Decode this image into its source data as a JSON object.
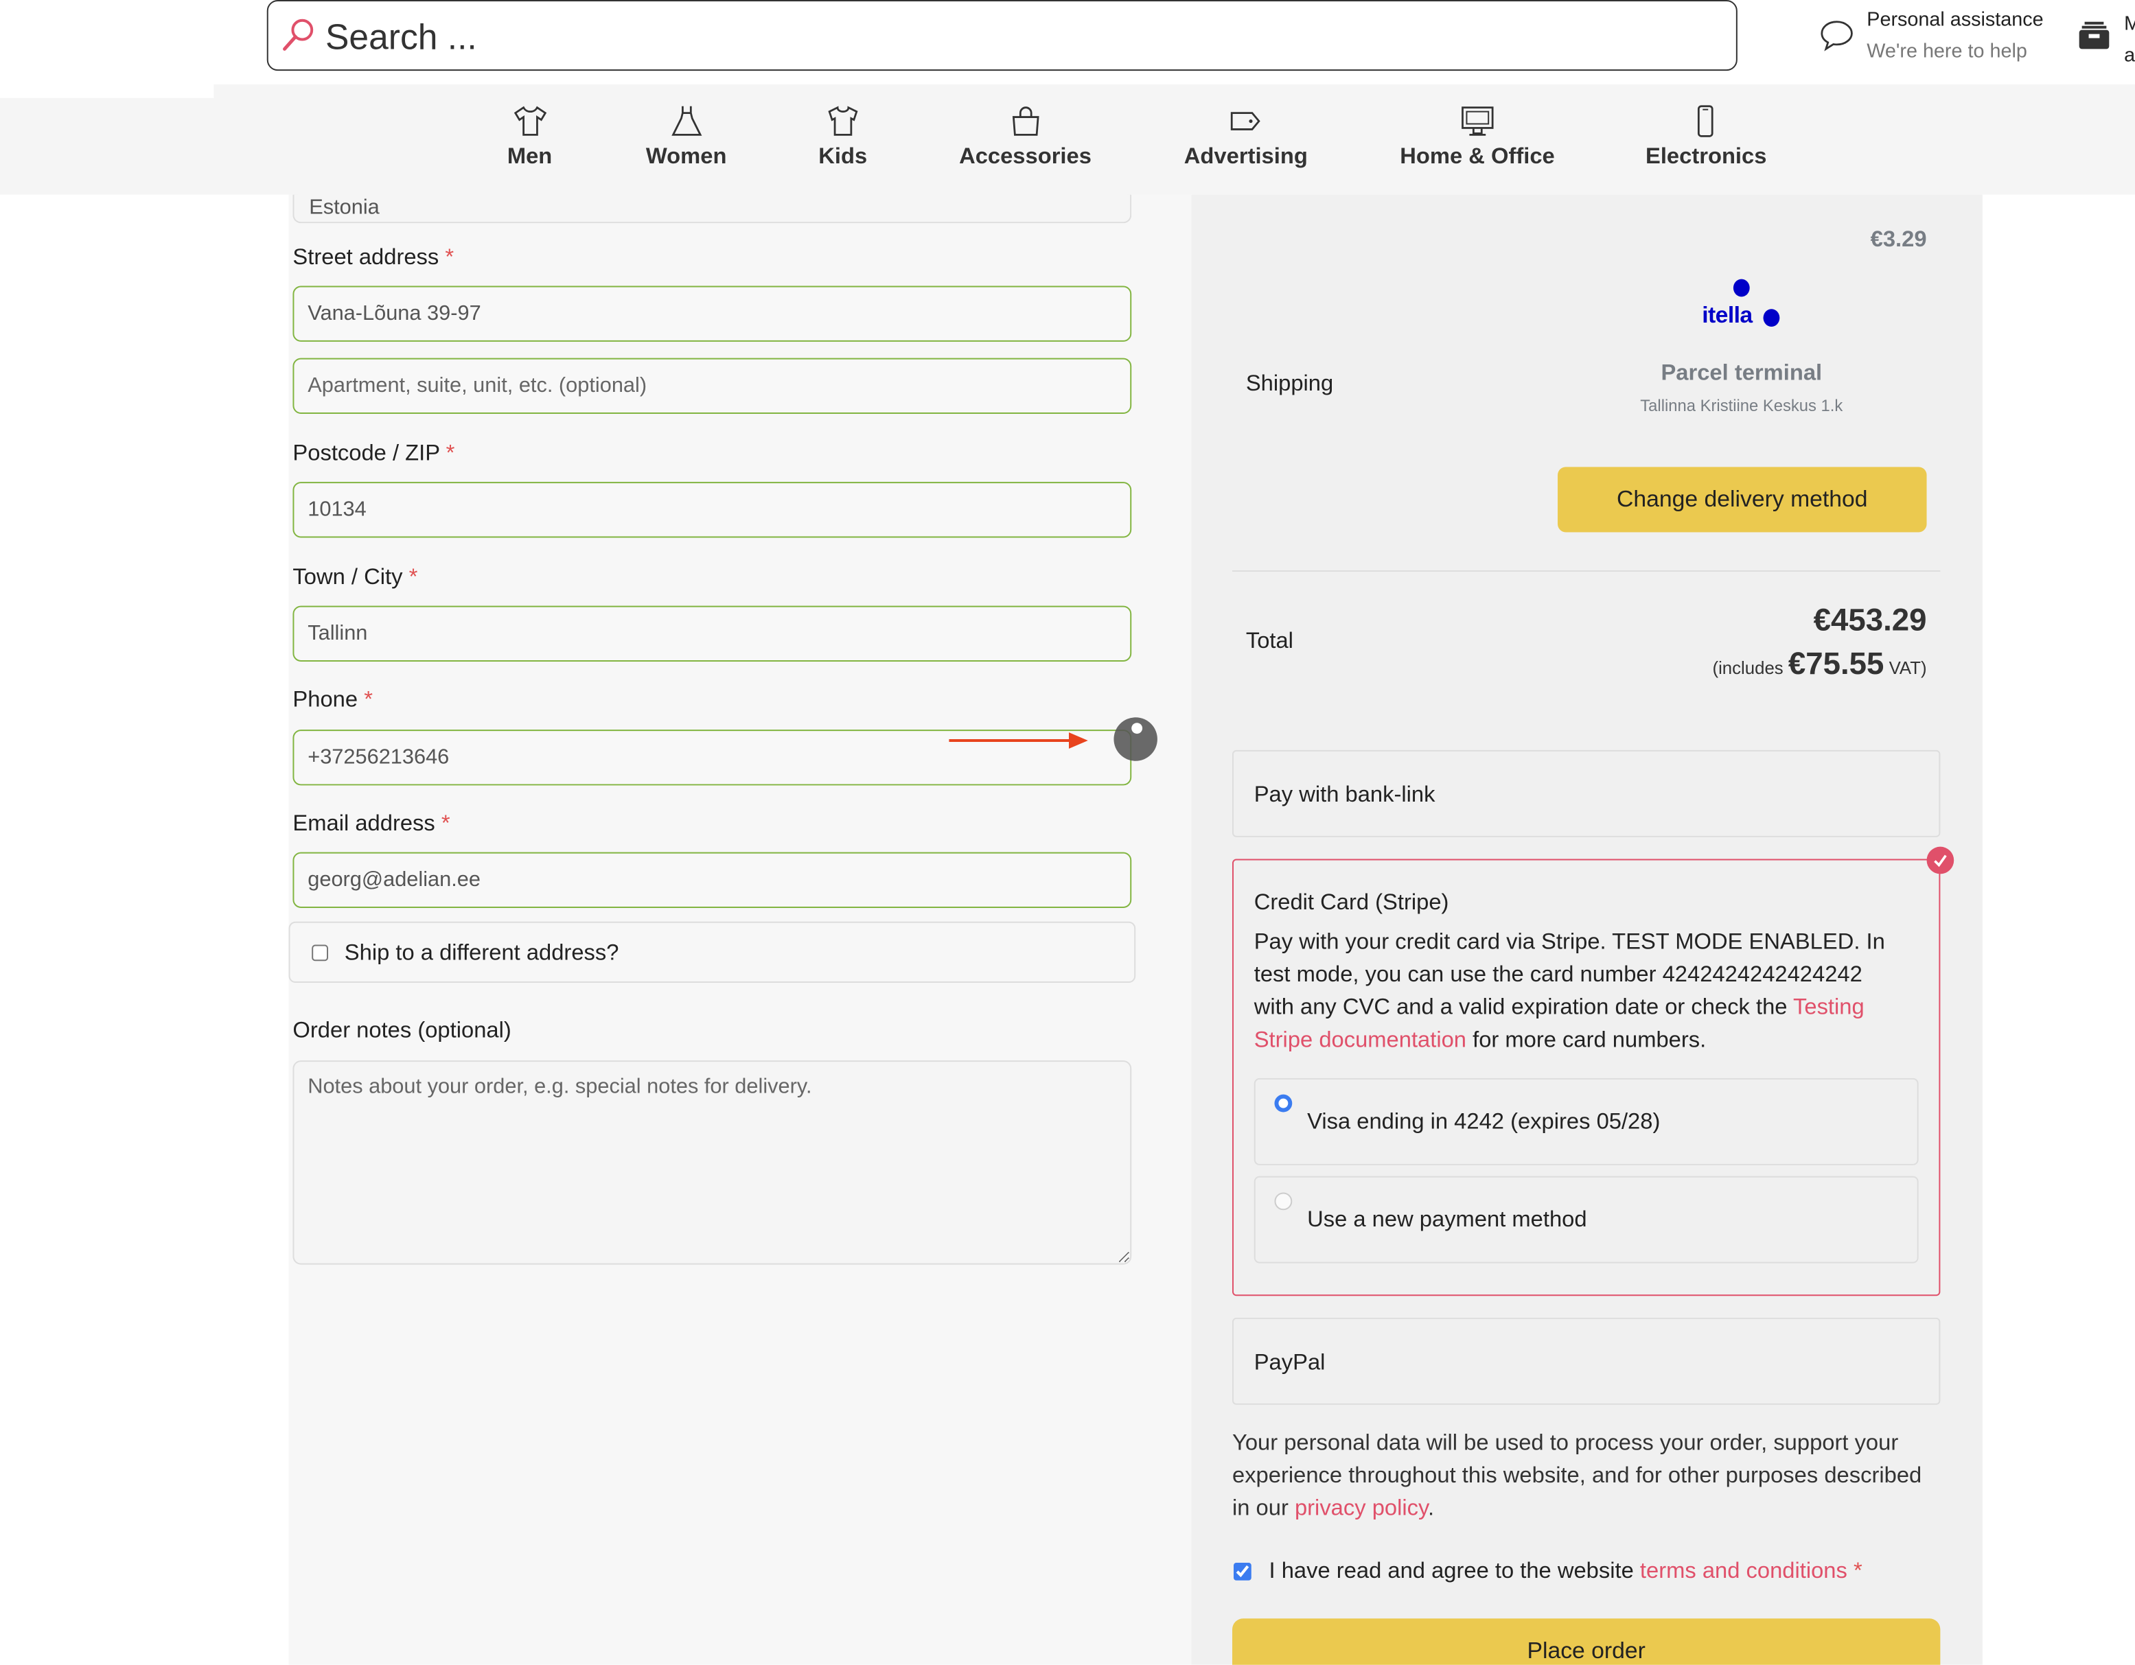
{
  "header": {
    "search_placeholder": "Search ...",
    "assistance_title": "Personal assistance",
    "assistance_subtitle": "We're here to help",
    "account_line1": "M",
    "account_line2": "a"
  },
  "nav": [
    {
      "label": "Men",
      "icon": "tshirt-icon"
    },
    {
      "label": "Women",
      "icon": "dress-icon"
    },
    {
      "label": "Kids",
      "icon": "kids-shirt-icon"
    },
    {
      "label": "Accessories",
      "icon": "bag-icon"
    },
    {
      "label": "Advertising",
      "icon": "tag-icon"
    },
    {
      "label": "Home & Office",
      "icon": "monitor-icon"
    },
    {
      "label": "Electronics",
      "icon": "phone-icon"
    }
  ],
  "form": {
    "country_value": "Estonia",
    "street_label": "Street address",
    "street_value": "Vana-Lõuna 39-97",
    "apartment_placeholder": "Apartment, suite, unit, etc. (optional)",
    "postcode_label": "Postcode / ZIP",
    "postcode_value": "10134",
    "city_label": "Town / City",
    "city_value": "Tallinn",
    "phone_label": "Phone",
    "phone_value": "+37256213646",
    "email_label": "Email address",
    "email_value": "georg@adelian.ee",
    "required_mark": "*",
    "ship_different_label": "Ship to a different address?",
    "ship_different_checked": false,
    "notes_label": "Order notes (optional)",
    "notes_placeholder": "Notes about your order, e.g. special notes for delivery."
  },
  "summary": {
    "shipping_price": "€3.29",
    "shipping_label": "Shipping",
    "carrier_logo_text": "itella",
    "shipping_method": "Parcel terminal",
    "shipping_location": "Tallinna Kristiine Keskus 1.k",
    "change_delivery_label": "Change delivery method",
    "total_label": "Total",
    "total_value": "€453.29",
    "vat_prefix": "(includes",
    "vat_value": "€75.55",
    "vat_suffix": "VAT)"
  },
  "payment": {
    "bank_link_label": "Pay with bank-link",
    "stripe_title": "Credit Card (Stripe)",
    "stripe_desc": "Pay with your credit card via Stripe. TEST MODE ENABLED. In test mode, you can use the card number 4242424242424242 with any CVC and a valid expiration date or check the ",
    "stripe_link": "Testing Stripe documentation",
    "stripe_desc_end": " for more card numbers.",
    "saved_card_label": "Visa ending in 4242 (expires 05/28)",
    "new_method_label": "Use a new payment method",
    "paypal_label": "PayPal",
    "privacy_text": "Your personal data will be used to process your order, support your experience throughout this website, and for other purposes described in our ",
    "privacy_link": "privacy policy",
    "privacy_end": ".",
    "terms_text": "I have read and agree to the website ",
    "terms_link": "terms and conditions",
    "terms_checked": true,
    "place_order_label": "Place order"
  },
  "colors": {
    "accent": "#e0506a",
    "valid_border": "#82b541",
    "button": "#ebc94f",
    "carrier_blue": "#0000c8",
    "annotation_arrow": "#e8441e"
  }
}
